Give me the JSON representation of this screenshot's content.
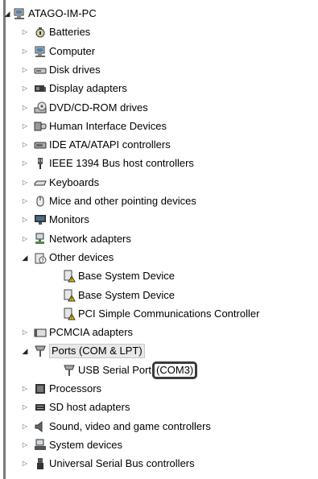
{
  "root": {
    "label": "ATAGO-IM-PC",
    "icon": "computer-icon",
    "expanded": true
  },
  "items": [
    {
      "label": "Batteries",
      "icon": "battery-icon",
      "expanded": false
    },
    {
      "label": "Computer",
      "icon": "computer-icon",
      "expanded": false
    },
    {
      "label": "Disk drives",
      "icon": "disk-drive-icon",
      "expanded": false
    },
    {
      "label": "Display adapters",
      "icon": "display-adapter-icon",
      "expanded": false
    },
    {
      "label": "DVD/CD-ROM drives",
      "icon": "dvd-drive-icon",
      "expanded": false
    },
    {
      "label": "Human Interface Devices",
      "icon": "hid-icon",
      "expanded": false
    },
    {
      "label": "IDE ATA/ATAPI controllers",
      "icon": "ide-controller-icon",
      "expanded": false
    },
    {
      "label": "IEEE 1394 Bus host controllers",
      "icon": "ieee1394-icon",
      "expanded": false
    },
    {
      "label": "Keyboards",
      "icon": "keyboard-icon",
      "expanded": false
    },
    {
      "label": "Mice and other pointing devices",
      "icon": "mouse-icon",
      "expanded": false
    },
    {
      "label": "Monitors",
      "icon": "monitor-icon",
      "expanded": false
    },
    {
      "label": "Network adapters",
      "icon": "network-adapter-icon",
      "expanded": false
    },
    {
      "label": "Other devices",
      "icon": "unknown-device-icon",
      "expanded": true,
      "children": [
        {
          "label": "Base System Device",
          "icon": "unknown-device-warning-icon"
        },
        {
          "label": "Base System Device",
          "icon": "unknown-device-warning-icon"
        },
        {
          "label": "PCI Simple Communications Controller",
          "icon": "unknown-device-warning-icon"
        }
      ]
    },
    {
      "label": "PCMCIA adapters",
      "icon": "pcmcia-icon",
      "expanded": false
    },
    {
      "label": "Ports (COM & LPT)",
      "icon": "port-icon",
      "expanded": true,
      "selected": true,
      "children": [
        {
          "label": "USB Serial Port",
          "highlight": "(COM3)",
          "icon": "port-icon"
        }
      ]
    },
    {
      "label": "Processors",
      "icon": "processor-icon",
      "expanded": false
    },
    {
      "label": "SD host adapters",
      "icon": "sd-adapter-icon",
      "expanded": false
    },
    {
      "label": "Sound, video and game controllers",
      "icon": "speaker-icon",
      "expanded": false
    },
    {
      "label": "System devices",
      "icon": "system-device-icon",
      "expanded": false
    },
    {
      "label": "Universal Serial Bus controllers",
      "icon": "usb-icon",
      "expanded": false
    }
  ],
  "colors": {
    "text": "#000000",
    "highlight_border": "#3a3a3a",
    "tree_line": "#999999"
  }
}
